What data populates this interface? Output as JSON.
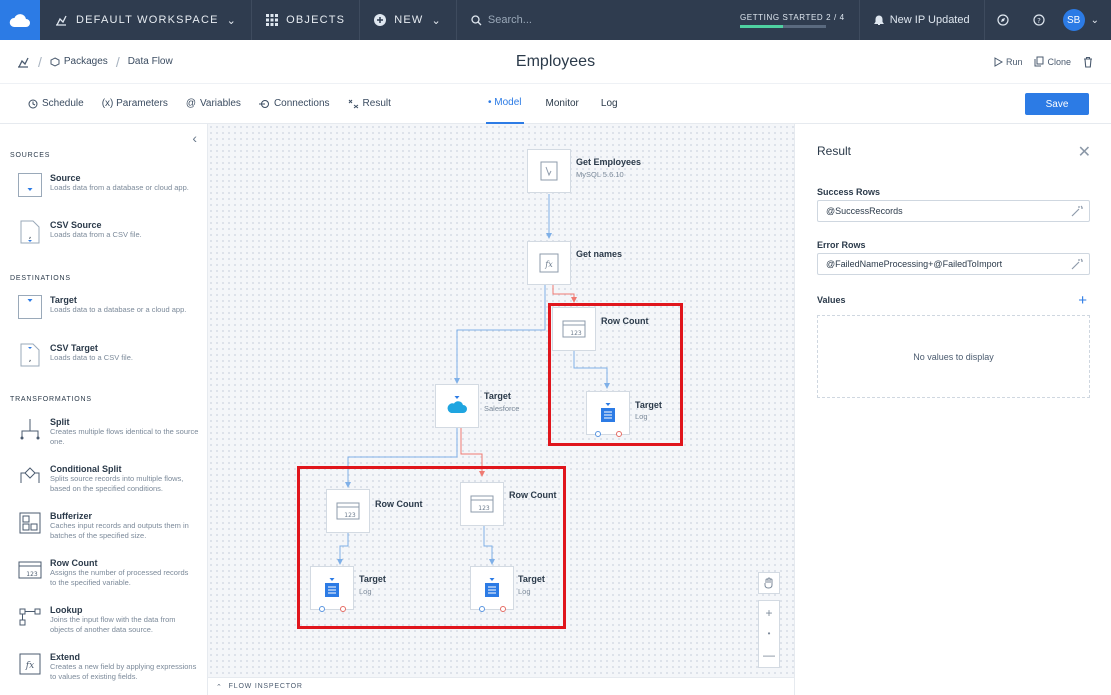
{
  "topbar": {
    "workspace": "DEFAULT WORKSPACE",
    "objects": "OBJECTS",
    "new": "NEW",
    "search_placeholder": "Search...",
    "getting_started": "GETTING STARTED 2 / 4",
    "getting_started_progress": 0.5,
    "notification": "New IP Updated",
    "avatar": "SB"
  },
  "titlebar": {
    "breadcrumb": [
      "Packages",
      "Data Flow"
    ],
    "title": "Employees",
    "run": "Run",
    "clone": "Clone"
  },
  "tabs": {
    "left": [
      "Schedule",
      "(x) Parameters",
      "Variables",
      "Connections",
      "Result"
    ],
    "middle": [
      "Model",
      "Monitor",
      "Log"
    ],
    "active": "Model",
    "save": "Save"
  },
  "sidebar": {
    "sections": [
      {
        "title": "SOURCES",
        "items": [
          {
            "name": "Source",
            "desc": "Loads data from a database or cloud app.",
            "icon": "source-icon"
          },
          {
            "name": "CSV Source",
            "desc": "Loads data from a CSV file.",
            "icon": "csv-source-icon"
          }
        ]
      },
      {
        "title": "DESTINATIONS",
        "items": [
          {
            "name": "Target",
            "desc": "Loads data to a database or a cloud app.",
            "icon": "target-icon"
          },
          {
            "name": "CSV Target",
            "desc": "Loads data to a CSV file.",
            "icon": "csv-target-icon"
          }
        ]
      },
      {
        "title": "TRANSFORMATIONS",
        "items": [
          {
            "name": "Split",
            "desc": "Creates multiple flows identical to the source one.",
            "icon": "split-icon"
          },
          {
            "name": "Conditional Split",
            "desc": "Splits source records into multiple flows, based on the specified conditions.",
            "icon": "conditional-split-icon"
          },
          {
            "name": "Bufferizer",
            "desc": "Caches input records and outputs them in batches of the specified size.",
            "icon": "bufferizer-icon"
          },
          {
            "name": "Row Count",
            "desc": "Assigns the number of processed records to the specified variable.",
            "icon": "row-count-icon"
          },
          {
            "name": "Lookup",
            "desc": "Joins the input flow with the data from objects of another data source.",
            "icon": "lookup-icon"
          },
          {
            "name": "Extend",
            "desc": "Creates a new field by applying expressions to values of existing fields.",
            "icon": "extend-icon"
          }
        ]
      }
    ]
  },
  "canvas": {
    "nodes": {
      "get_employees": {
        "label": "Get Employees",
        "sub": "MySQL 5.6.10"
      },
      "get_names": {
        "label": "Get names",
        "sub": ""
      },
      "row_count_1": {
        "label": "Row Count",
        "sub": ""
      },
      "target_log_1": {
        "label": "Target",
        "sub": "Log"
      },
      "target_salesforce": {
        "label": "Target",
        "sub": "Salesforce"
      },
      "row_count_2": {
        "label": "Row Count",
        "sub": ""
      },
      "row_count_3": {
        "label": "Row Count",
        "sub": ""
      },
      "target_log_2": {
        "label": "Target",
        "sub": "Log"
      },
      "target_log_3": {
        "label": "Target",
        "sub": "Log"
      }
    },
    "flow_inspector": "FLOW INSPECTOR"
  },
  "panel": {
    "title": "Result",
    "success_label": "Success Rows",
    "success_value": "@SuccessRecords",
    "error_label": "Error Rows",
    "error_value": "@FailedNameProcessing+@FailedToImport",
    "values_label": "Values",
    "values_empty": "No values to display"
  },
  "colors": {
    "accent": "#2c7be5",
    "topbar": "#2f3c4f",
    "highlight": "#e0151c",
    "success_wire": "#7fb0e8",
    "error_wire": "#ef7a72"
  }
}
